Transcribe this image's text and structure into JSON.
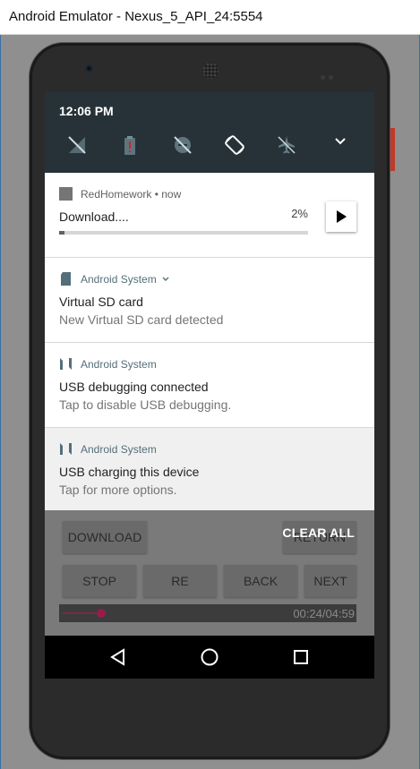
{
  "window": {
    "title": "Android Emulator - Nexus_5_API_24:5554"
  },
  "status_bar": {
    "time": "12:06 PM"
  },
  "quick_settings": {
    "tiles": [
      {
        "icon": "signal-off-icon"
      },
      {
        "icon": "battery-alert-icon"
      },
      {
        "icon": "do-not-disturb-off-icon"
      },
      {
        "icon": "auto-rotate-icon"
      },
      {
        "icon": "airplane-mode-icon"
      }
    ],
    "expand_icon": "chevron-down-icon"
  },
  "notifications": [
    {
      "app": "RedHomework",
      "time": "now",
      "title": "Download....",
      "progress_percent": "2%",
      "progress_value": 0.02,
      "action_icon": "play-icon"
    },
    {
      "app": "Android System",
      "title": "Virtual SD card",
      "text": "New Virtual SD card detected"
    },
    {
      "app": "Android System",
      "title": "USB debugging connected",
      "text": "Tap to disable USB debugging."
    },
    {
      "app": "Android System",
      "title": "USB charging this device",
      "text": "Tap for more options."
    }
  ],
  "clear_all": "CLEAR ALL",
  "app_behind": {
    "download_label": "DOWNLOAD",
    "return_label": "RETURN",
    "stop_label": "STOP",
    "re_label": "RE",
    "back_label": "BACK",
    "next_label": "NEXT",
    "time": "00:24/04:59",
    "seek_fraction": 0.08
  },
  "nav": {
    "back": "back-triangle-icon",
    "home": "home-circle-icon",
    "recents": "recents-square-icon"
  },
  "colors": {
    "qs_bg": "#263238",
    "accent_seek": "#9a1b4a"
  }
}
